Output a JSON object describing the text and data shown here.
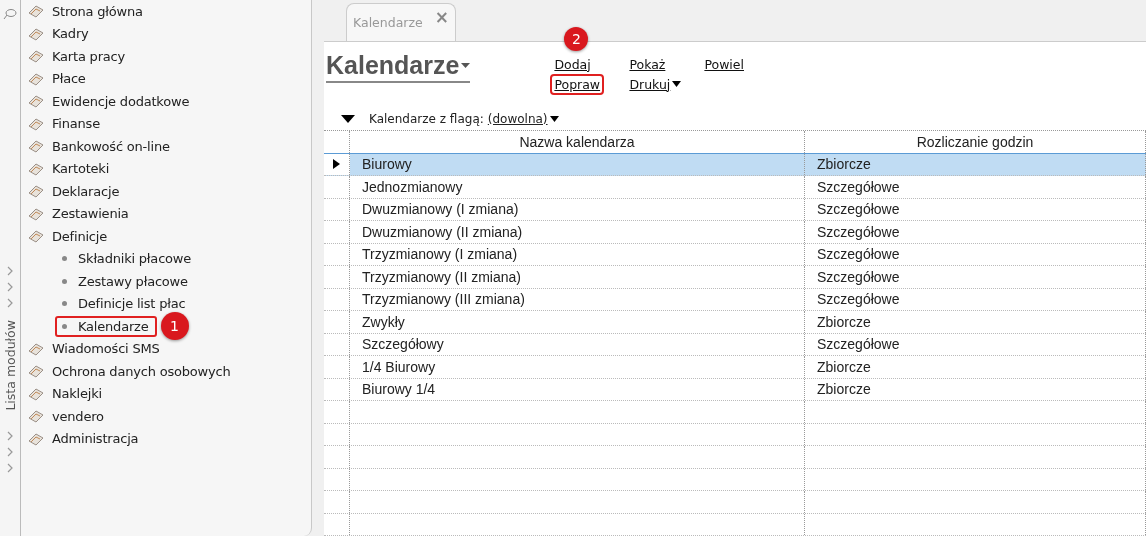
{
  "module_strip": {
    "label": "Lista modułów"
  },
  "sidebar": {
    "items": [
      {
        "label": "Strona główna"
      },
      {
        "label": "Kadry"
      },
      {
        "label": "Karta pracy"
      },
      {
        "label": "Płace"
      },
      {
        "label": "Ewidencje dodatkowe"
      },
      {
        "label": "Finanse"
      },
      {
        "label": "Bankowość on-line"
      },
      {
        "label": "Kartoteki"
      },
      {
        "label": "Deklaracje"
      },
      {
        "label": "Zestawienia"
      },
      {
        "label": "Definicje",
        "children": [
          {
            "label": "Składniki płacowe"
          },
          {
            "label": "Zestawy płacowe"
          },
          {
            "label": "Definicje list płac"
          },
          {
            "label": "Kalendarze",
            "callout": "1"
          }
        ]
      },
      {
        "label": "Wiadomości SMS"
      },
      {
        "label": "Ochrona danych osobowych"
      },
      {
        "label": "Naklejki"
      },
      {
        "label": "vendero"
      },
      {
        "label": "Administracja"
      }
    ]
  },
  "tab": {
    "label": "Kalendarze",
    "close": "×"
  },
  "header": {
    "title": "Kalendarze",
    "action_columns": [
      [
        {
          "label": "Dodaj"
        },
        {
          "label": "Popraw",
          "callout": "2"
        }
      ],
      [
        {
          "label": "Pokaż"
        },
        {
          "label": "Drukuj",
          "dropdown": true
        }
      ],
      [
        {
          "label": "Powiel"
        }
      ]
    ]
  },
  "filter": {
    "label": "Kalendarze z flagą:",
    "value": "(dowolna)"
  },
  "table": {
    "columns": [
      "Nazwa kalendarza",
      "Rozliczanie godzin"
    ],
    "rows": [
      {
        "cells": [
          "Biurowy",
          "Zbiorcze"
        ],
        "selected": true
      },
      {
        "cells": [
          "Jednozmianowy",
          "Szczegółowe"
        ],
        "selected": false
      },
      {
        "cells": [
          "Dwuzmianowy (I zmiana)",
          "Szczegółowe"
        ],
        "selected": false
      },
      {
        "cells": [
          "Dwuzmianowy (II zmiana)",
          "Szczegółowe"
        ],
        "selected": false
      },
      {
        "cells": [
          "Trzyzmianowy (I zmiana)",
          "Szczegółowe"
        ],
        "selected": false
      },
      {
        "cells": [
          "Trzyzmianowy (II zmiana)",
          "Szczegółowe"
        ],
        "selected": false
      },
      {
        "cells": [
          "Trzyzmianowy (III zmiana)",
          "Szczegółowe"
        ],
        "selected": false
      },
      {
        "cells": [
          "Zwykły",
          "Zbiorcze"
        ],
        "selected": false
      },
      {
        "cells": [
          "Szczegółowy",
          "Szczegółowe"
        ],
        "selected": false
      },
      {
        "cells": [
          "1/4 Biurowy",
          "Zbiorcze"
        ],
        "selected": false
      },
      {
        "cells": [
          "Biurowy 1/4",
          "Zbiorcze"
        ],
        "selected": false
      }
    ]
  }
}
